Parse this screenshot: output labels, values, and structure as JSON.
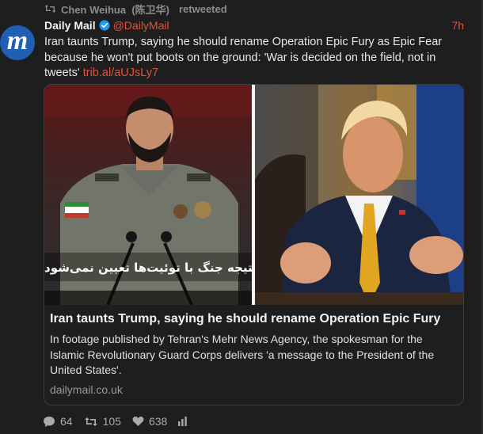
{
  "retweet": {
    "icon": "retweet-icon",
    "user": "Chen Weihua  (陈卫华)",
    "label": "retweeted"
  },
  "tweet": {
    "avatar_icon": "daily-mail-logo",
    "avatar_letter": "m",
    "display_name": "Daily Mail",
    "verified_icon": "verified-badge-icon",
    "handle": "@DailyMail",
    "time": "7h",
    "text": "Iran taunts Trump, saying he should rename Operation Epic Fury as Epic Fear because he won't put boots on the ground: 'War is decided on the field, not in tweets'",
    "link": "trib.al/aUJsLy7"
  },
  "card": {
    "image_left": "iranian-military-spokesman-photo",
    "image_right": "donald-trump-photo",
    "caption_text": "نتیجه جنگ با توئیت‌ها تعیین نمی‌شود!",
    "title": "Iran taunts Trump, saying he should rename Operation Epic Fury",
    "description": "In footage published by Tehran's Mehr News Agency, the spokesman for the Islamic Revolutionary Guard Corps delivers 'a message to the President of the United States'.",
    "domain": "dailymail.co.uk"
  },
  "actions": {
    "replies": "64",
    "retweets": "105",
    "likes": "638"
  },
  "colors": {
    "background": "#1e1e1e",
    "accent": "#e0533d",
    "verified": "#1d9bf0"
  }
}
